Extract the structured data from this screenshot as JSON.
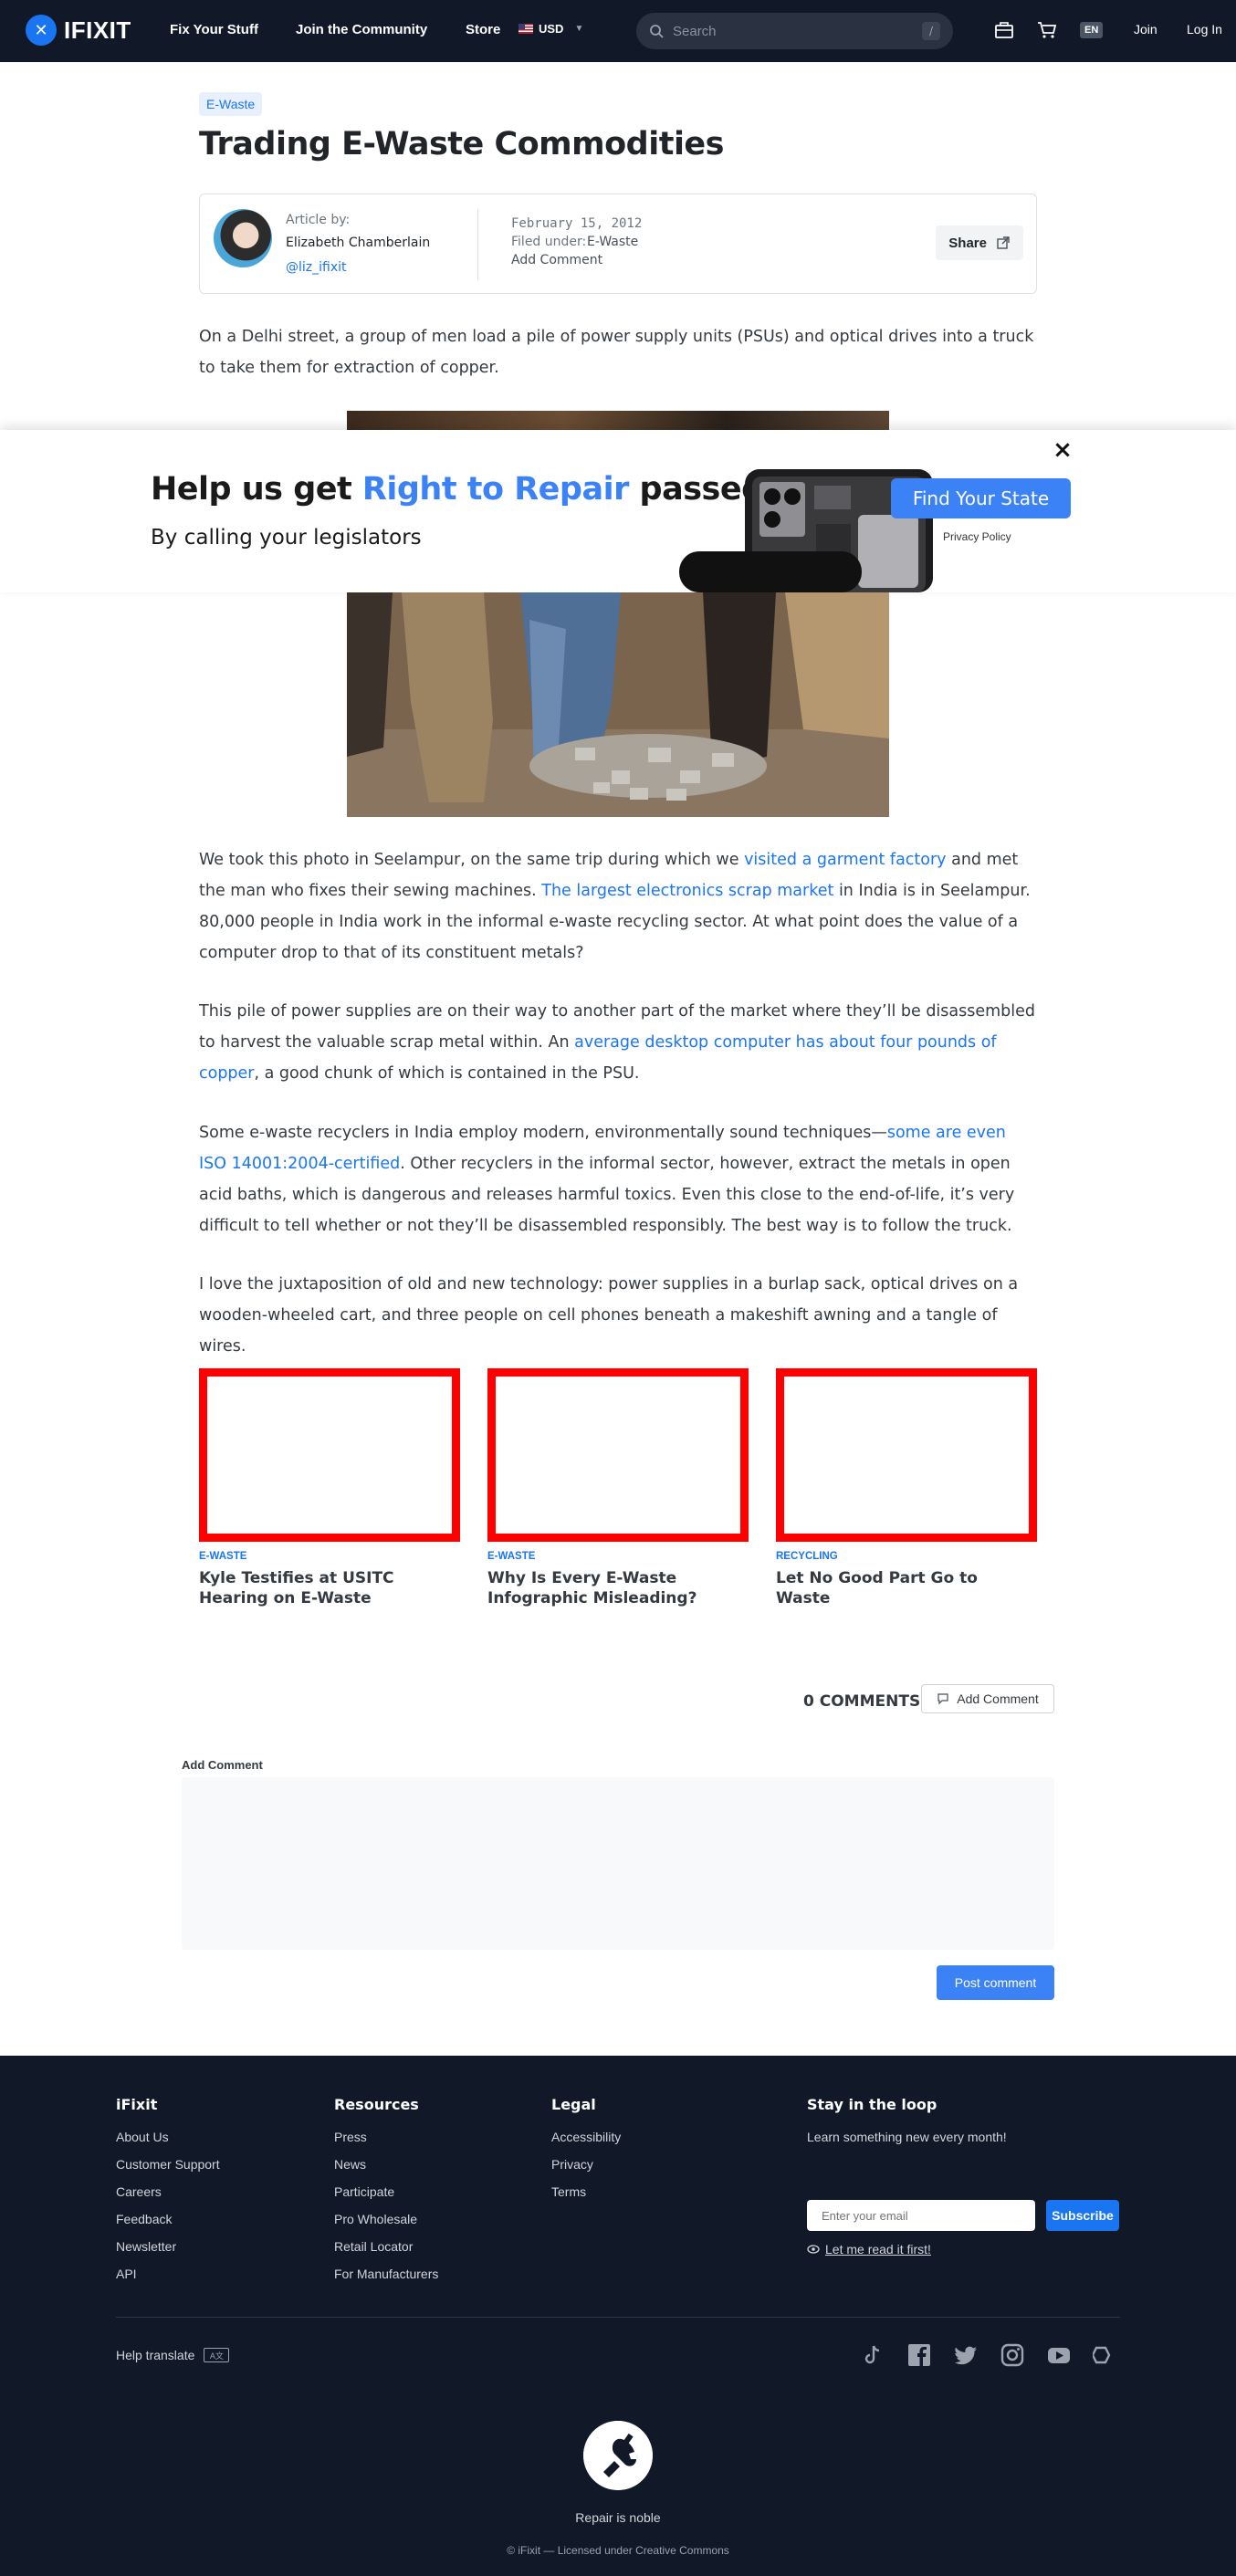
{
  "nav": {
    "logo_text": "IFIXIT",
    "links": [
      "Fix Your Stuff",
      "Join the Community",
      "Store"
    ],
    "currency": "USD",
    "search_placeholder": "Search",
    "search_shortcut": "/",
    "language": "EN",
    "join": "Join",
    "login": "Log In",
    "icons": [
      "toolbox-icon",
      "cart-icon"
    ]
  },
  "article": {
    "tag": "E-Waste",
    "title": "Trading E-Waste Commodities",
    "author_label": "Article by:",
    "author_name": "Elizabeth Chamberlain",
    "author_handle": "@liz_ifixit",
    "date": "February 15, 2012",
    "filed_label": "Filed under:",
    "filed_value": "E-Waste",
    "add_comment": "Add Comment",
    "share": "Share",
    "intro": "On a Delhi street, a group of men load a pile of power supply units (PSUs) and optical drives into a truck to take them for extraction of copper.",
    "p1_a": "We took this photo in Seelampur, on the same trip during which we ",
    "p1_link1": "visited a garment factory",
    "p1_b": " and met the man who fixes their sewing machines. ",
    "p1_link2": "The largest electronics scrap market",
    "p1_c": " in India is in Seelampur. 80,000 people in India work in the informal e-waste recycling sector. At what point does the value of a computer drop to that of its constituent metals?",
    "p2_a": "This pile of power supplies are on their way to another part of the market where they’ll be disassembled to harvest the valuable scrap metal within. An ",
    "p2_link": "average desktop computer has about four pounds of copper",
    "p2_b": ", a good chunk of which is contained in the PSU.",
    "p3_a": "Some e-waste recyclers in India employ modern, environmentally sound techniques—",
    "p3_link": "some are even ISO 14001:2004-certified",
    "p3_b": ". Other recyclers in the informal sector, however, extract the metals in open acid baths, which is dangerous and releases harmful toxics. Even this close to the end-of-life, it’s very difficult to tell whether or not they’ll be disassembled responsibly. The best way is to follow the truck.",
    "p4": "I love the juxtaposition of old and new technology: power supplies in a burlap sack, optical drives on a wooden-wheeled cart, and three people on cell phones beneath a makeshift awning and a tangle of wires."
  },
  "modal": {
    "heading_a": "Help us get ",
    "heading_accent": "Right to Repair",
    "heading_b": " passed",
    "subheading": "By calling your legislators",
    "cta": "Find Your State",
    "privacy": "Privacy Policy",
    "close": "×",
    "accent_color": "#3b82f6"
  },
  "related": [
    {
      "tag": "E-WASTE",
      "title": "Kyle Testifies at USITC Hearing on E-Waste"
    },
    {
      "tag": "E-WASTE",
      "title": "Why Is Every E-Waste Infographic Misleading?"
    },
    {
      "tag": "RECYCLING",
      "title": "Let No Good Part Go to Waste"
    }
  ],
  "comments": {
    "count_label": "0 COMMENTS",
    "add_button": "Add Comment",
    "form_label": "Add Comment",
    "post_button": "Post comment"
  },
  "footer": {
    "col1": {
      "heading": "iFixit",
      "links": [
        "About Us",
        "Customer Support",
        "Careers",
        "Feedback",
        "Newsletter",
        "API"
      ]
    },
    "col2": {
      "heading": "Resources",
      "links": [
        "Press",
        "News",
        "Participate",
        "Pro Wholesale",
        "Retail Locator",
        "For Manufacturers"
      ]
    },
    "col3": {
      "heading": "Legal",
      "links": [
        "Accessibility",
        "Privacy",
        "Terms"
      ]
    },
    "newsletter": {
      "heading": "Stay in the loop",
      "subtext": "Learn something new every month!",
      "email_placeholder": "Enter your email",
      "subscribe": "Subscribe",
      "read_first": "Let me read it first!"
    },
    "translate": "Help translate",
    "social_icons": [
      "tiktok-icon",
      "facebook-icon",
      "twitter-icon",
      "instagram-icon",
      "youtube-icon",
      "repair-org-icon"
    ],
    "tagline": "Repair is noble",
    "copyright": "© iFixit — Licensed under Creative Commons"
  }
}
